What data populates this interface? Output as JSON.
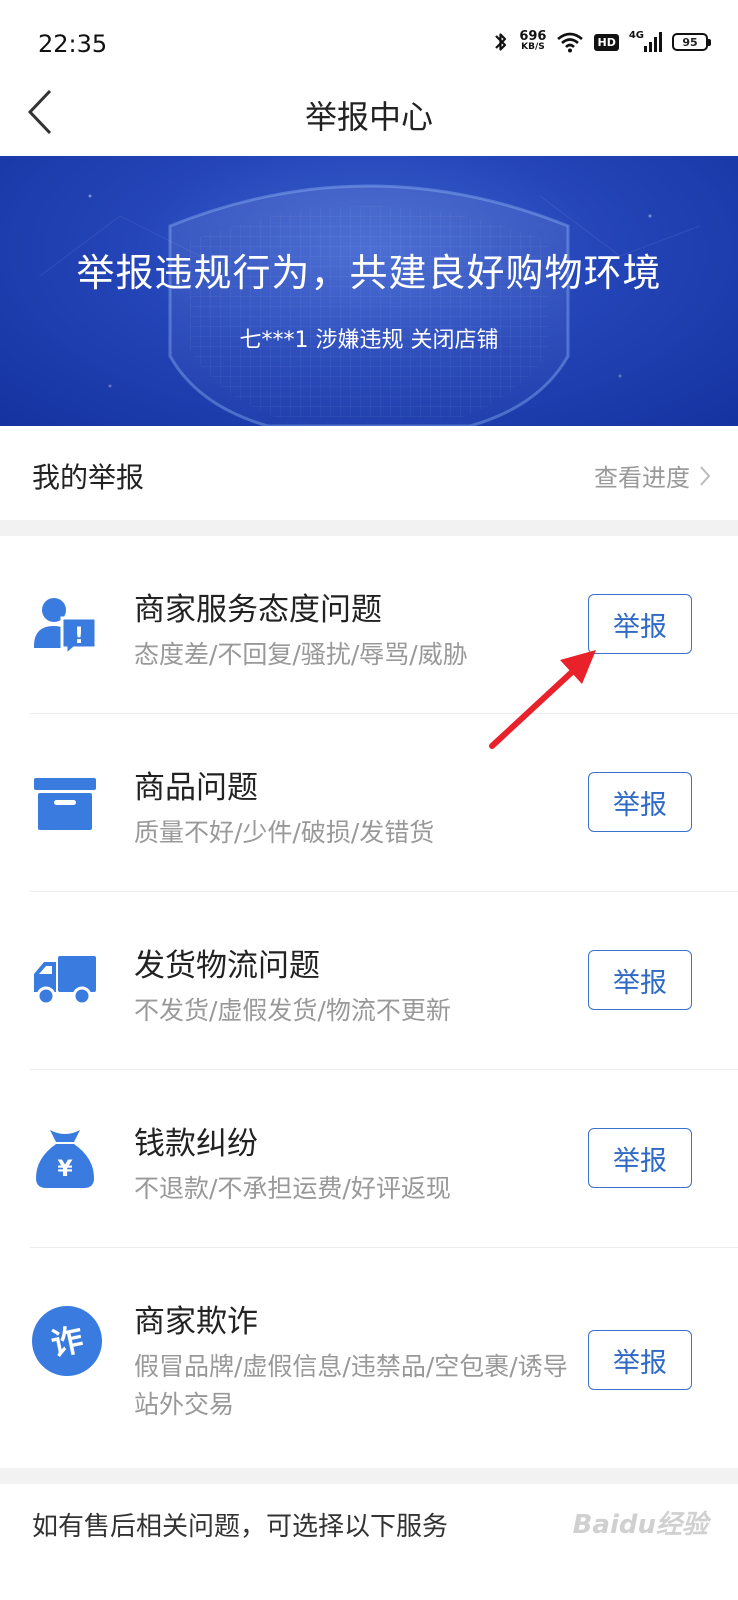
{
  "status_bar": {
    "time": "22:35",
    "net_speed_value": "696",
    "net_speed_unit": "KB/S",
    "hd_label": "HD",
    "signal_label": "4G",
    "battery": "95",
    "icons": [
      "bluetooth-icon",
      "wifi-icon",
      "signal-icon",
      "battery-icon"
    ]
  },
  "nav": {
    "title": "举报中心",
    "back_icon": "chevron-left-icon"
  },
  "banner": {
    "title": "举报违规行为，共建良好购物环境",
    "subtitle": "七***1 涉嫌违规 关闭店铺"
  },
  "my_reports": {
    "label": "我的举报",
    "link_label": "查看进度"
  },
  "categories": [
    {
      "icon": "user-alert-icon",
      "title": "商家服务态度问题",
      "desc": "态度差/不回复/骚扰/辱骂/威胁",
      "button": "举报"
    },
    {
      "icon": "box-icon",
      "title": "商品问题",
      "desc": "质量不好/少件/破损/发错货",
      "button": "举报"
    },
    {
      "icon": "truck-icon",
      "title": "发货物流问题",
      "desc": "不发货/虚假发货/物流不更新",
      "button": "举报"
    },
    {
      "icon": "money-bag-icon",
      "title": "钱款纠纷",
      "desc": "不退款/不承担运费/好评返现",
      "button": "举报"
    },
    {
      "icon": "fraud-icon",
      "title": "商家欺诈",
      "desc": "假冒品牌/虚假信息/违禁品/空包裹/诱导站外交易",
      "button": "举报"
    }
  ],
  "icon_glyphs": {
    "yen": "¥",
    "fraud": "诈",
    "exclaim": "!"
  },
  "footer": {
    "text": "如有售后相关问题，可选择以下服务",
    "watermark": "Baidu经验"
  },
  "colors": {
    "primary": "#2f6ac4",
    "icon_blue": "#3a7be0",
    "banner": "#2445b8",
    "annotation": "#e8212a"
  }
}
